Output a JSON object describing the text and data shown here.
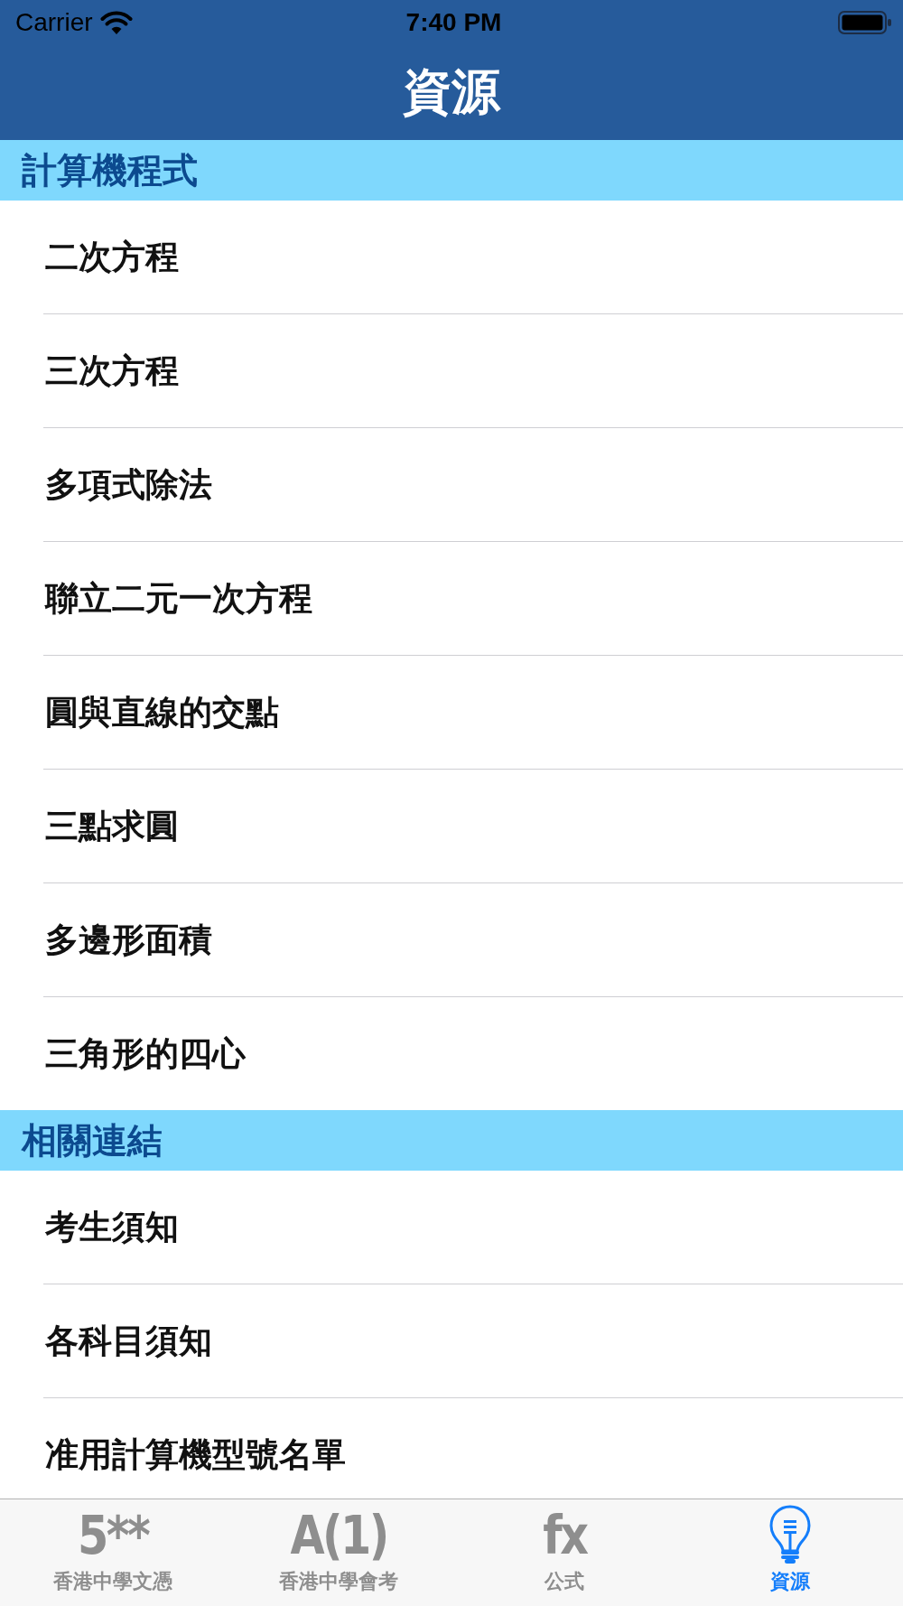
{
  "status_bar": {
    "carrier": "Carrier",
    "time": "7:40 PM"
  },
  "nav_bar": {
    "title": "資源"
  },
  "sections": [
    {
      "title": "計算機程式",
      "items": [
        "二次方程",
        "三次方程",
        "多項式除法",
        "聯立二元一次方程",
        "圓與直線的交點",
        "三點求圓",
        "多邊形面積",
        "三角形的四心"
      ]
    },
    {
      "title": "相關連結",
      "items": [
        "考生須知",
        "各科目須知",
        "准用計算機型號名單"
      ]
    }
  ],
  "tab_bar": [
    {
      "kind": "glyph",
      "icon_text": "5**",
      "label": "香港中學文憑",
      "selected": false
    },
    {
      "kind": "glyph",
      "icon_text": "A(1)",
      "label": "香港中學會考",
      "selected": false
    },
    {
      "kind": "glyph",
      "icon_text": "fx",
      "label": "公式",
      "selected": false
    },
    {
      "kind": "bulb",
      "label": "資源",
      "selected": true
    }
  ]
}
